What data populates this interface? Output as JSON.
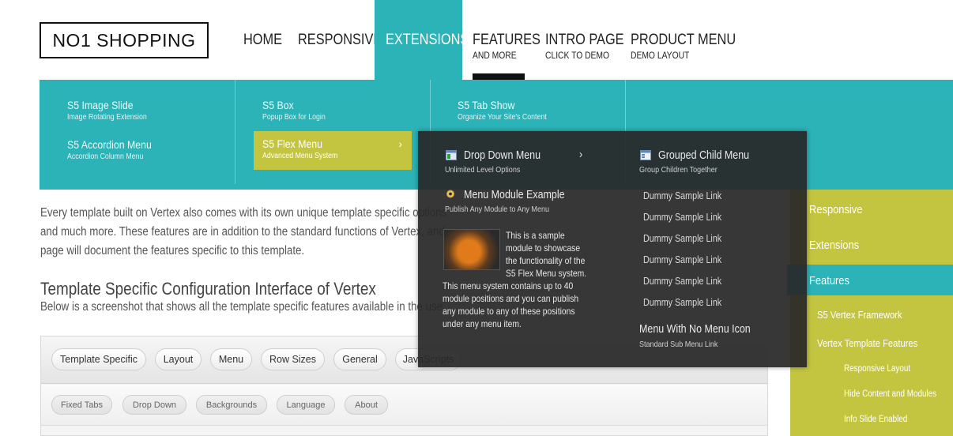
{
  "header": {
    "logo": "NO1 SHOPPING",
    "nav": [
      {
        "label": "HOME",
        "sub": ""
      },
      {
        "label": "RESPONSIVE",
        "sub": ""
      },
      {
        "label": "EXTENSIONS",
        "sub": ""
      },
      {
        "label": "FEATURES",
        "sub": "AND MORE"
      },
      {
        "label": "INTRO PAGE",
        "sub": "CLICK TO DEMO"
      },
      {
        "label": "PRODUCT MENU",
        "sub": "DEMO LAYOUT"
      }
    ]
  },
  "mega_menu": {
    "items": [
      {
        "title": "S5 Image Slide",
        "sub": "Image Rotating Extension"
      },
      {
        "title": "S5 Accordion Menu",
        "sub": "Accordion Column Menu"
      },
      {
        "title": "S5 Box",
        "sub": "Popup Box for Login"
      },
      {
        "title": "S5 Flex Menu",
        "sub": "Advanced Menu System"
      },
      {
        "title": "S5 Tab Show",
        "sub": "Organize Your Site's Content"
      }
    ],
    "arrow": "›"
  },
  "flyout": {
    "dropdown": {
      "title": "Drop Down Menu",
      "sub": "Unlimited Level Options"
    },
    "module": {
      "title": "Menu Module Example",
      "sub": "Publish Any Module to Any Menu"
    },
    "body_lines_right": [
      "This is a sample",
      "module to showcase",
      "the functionality of the",
      "S5 Flex Menu system."
    ],
    "body_lines_full": [
      "This menu system contains up to 40",
      "module positions and you can publish",
      "any module to any of these positions",
      "under any menu item."
    ],
    "grouped": {
      "title": "Grouped Child Menu",
      "sub": "Group Children Together"
    },
    "links": [
      "Dummy Sample Link",
      "Dummy Sample Link",
      "Dummy Sample Link",
      "Dummy Sample Link",
      "Dummy Sample Link",
      "Dummy Sample Link"
    ],
    "no_icon": {
      "title": "Menu With No Menu Icon",
      "sub": "Standard Sub Menu Link"
    }
  },
  "content": {
    "para_lines": [
      "Every template built on Vertex also comes with its own unique template specific options",
      "and much more. These features are in addition to the standard functions of Vertex, and",
      "page will document the features specific to this template."
    ],
    "heading": "Template Specific Configuration Interface of Vertex",
    "below": "Below is a screenshot that shows all the template specific features available in the use"
  },
  "panel": {
    "tabs": [
      "Template Specific",
      "Layout",
      "Menu",
      "Row Sizes",
      "General",
      "JavaScripts"
    ],
    "subtabs": [
      "Fixed Tabs",
      "Drop Down",
      "Backgrounds",
      "Language",
      "About"
    ]
  },
  "sidebar": {
    "items": [
      "Responsive",
      "Extensions",
      "Features"
    ],
    "sub1": [
      "S5 Vertex Framework",
      "Vertex Template Features"
    ],
    "sub2": [
      "Responsive Layout",
      "Hide Content and Modules",
      "Info Slide Enabled"
    ]
  },
  "colors": {
    "teal": "#2bb3b8",
    "lime": "#c3c540",
    "flyout": "#2a2a2a"
  }
}
